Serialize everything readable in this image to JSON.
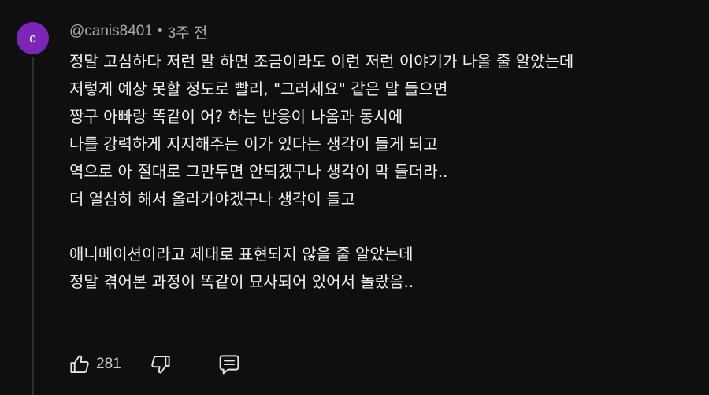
{
  "comment": {
    "avatar_letter": "c",
    "avatar_color": "#7b25b9",
    "author": "@canis8401",
    "separator": "•",
    "time_ago": "3주 전",
    "lines": [
      "정말 고심하다 저런 말 하면 조금이라도 이런 저런 이야기가 나올 줄 알았는데",
      "저렇게 예상 못할 정도로 빨리, \"그러세요\" 같은 말 들으면",
      "짱구 아빠랑 똑같이 어? 하는 반응이 나옴과 동시에",
      "나를 강력하게 지지해주는 이가 있다는 생각이 들게 되고",
      "역으로 아 절대로 그만두면 안되겠구나 생각이 막 들더라..",
      "더 열심히 해서 올라가야겠구나 생각이 들고",
      "",
      "애니메이션이라고 제대로 표현되지 않을 줄 알았는데",
      "정말 겪어본 과정이 똑같이 묘사되어 있어서 놀랐음.."
    ]
  },
  "actions": {
    "like_icon": "thumb-up-icon",
    "like_count": "281",
    "dislike_icon": "thumb-down-icon",
    "reply_icon": "comment-icon"
  }
}
